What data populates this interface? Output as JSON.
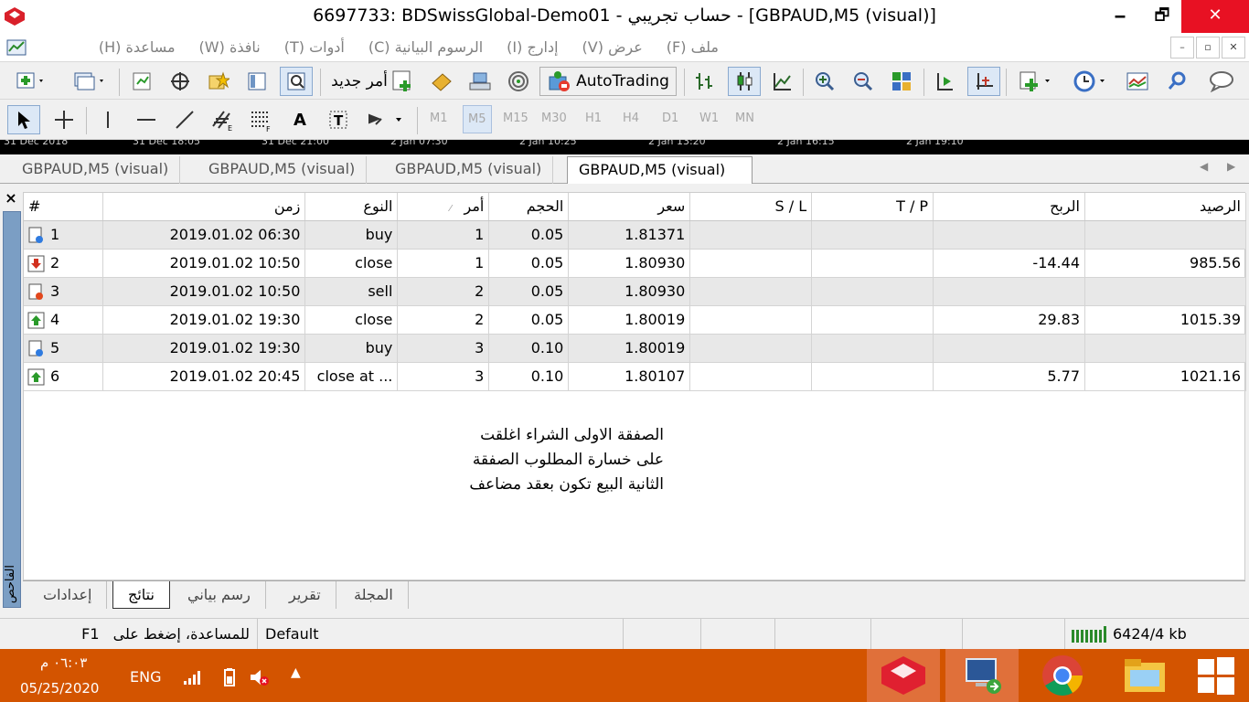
{
  "window": {
    "title": "6697733: BDSwissGlobal-Demo01 - حساب تجريبي - [GBPAUD,M5 (visual)]",
    "minimize": "🗕",
    "maximize": "🗗",
    "close": "✕"
  },
  "menu": {
    "items": [
      "ملف (F)",
      "عرض (V)",
      "إدارج (I)",
      "الرسوم البيانية (C)",
      "أدوات (T)",
      "نافذة (W)",
      "مساعدة (H)"
    ],
    "mdi_min": "–",
    "mdi_restore": "▫",
    "mdi_close": "✕"
  },
  "toolbar": {
    "new_order": "أمر جديد",
    "autotrading": "AutoTrading",
    "line_tools": [
      "T"
    ],
    "text_tool": "A",
    "timeframes": [
      "M1",
      "M5",
      "M15",
      "M30",
      "H1",
      "H4",
      "D1",
      "W1",
      "MN"
    ]
  },
  "chart_strip": {
    "labels": [
      "31 Dec 2018",
      "31 Dec 18:05",
      "31 Dec 21:00",
      "2 Jan 07:30",
      "2 Jan 10:25",
      "2 Jan 13:20",
      "2 Jan 16:15",
      "2 Jan 19:10"
    ]
  },
  "chart_tabs": [
    "GBPAUD,M5 (visual)",
    "GBPAUD,M5 (visual)",
    "GBPAUD,M5 (visual)",
    "GBPAUD,M5 (visual)"
  ],
  "panel": {
    "close": "×",
    "side_label": "الفاحص"
  },
  "columns": {
    "num": "#",
    "time": "زمن",
    "type": "النوع",
    "order": "أمر",
    "volume": "الحجم",
    "price": "سعر",
    "sl": "S / L",
    "tp": "T / P",
    "profit": "الربح",
    "balance": "الرصيد"
  },
  "rows": [
    {
      "num": "1",
      "time": "2019.01.02 06:30",
      "type": "buy",
      "order": "1",
      "volume": "0.05",
      "price": "1.81371",
      "sl": "",
      "tp": "",
      "profit": "",
      "balance": "",
      "icon": "buy-order-icon"
    },
    {
      "num": "2",
      "time": "2019.01.02 10:50",
      "type": "close",
      "order": "1",
      "volume": "0.05",
      "price": "1.80930",
      "sl": "",
      "tp": "",
      "profit": "-14.44",
      "balance": "985.56",
      "icon": "close-loss-icon"
    },
    {
      "num": "3",
      "time": "2019.01.02 10:50",
      "type": "sell",
      "order": "2",
      "volume": "0.05",
      "price": "1.80930",
      "sl": "",
      "tp": "",
      "profit": "",
      "balance": "",
      "icon": "sell-order-icon"
    },
    {
      "num": "4",
      "time": "2019.01.02 19:30",
      "type": "close",
      "order": "2",
      "volume": "0.05",
      "price": "1.80019",
      "sl": "",
      "tp": "",
      "profit": "29.83",
      "balance": "1015.39",
      "icon": "close-profit-icon"
    },
    {
      "num": "5",
      "time": "2019.01.02 19:30",
      "type": "buy",
      "order": "3",
      "volume": "0.10",
      "price": "1.80019",
      "sl": "",
      "tp": "",
      "profit": "",
      "balance": "",
      "icon": "buy-order-icon"
    },
    {
      "num": "6",
      "time": "2019.01.02 20:45",
      "type": "close at ...",
      "order": "3",
      "volume": "0.10",
      "price": "1.80107",
      "sl": "",
      "tp": "",
      "profit": "5.77",
      "balance": "1021.16",
      "icon": "close-profit-icon"
    }
  ],
  "note": {
    "line1": "الصفقة الاولى الشراء اغلقت",
    "line2": "على خسارة المطلوب الصفقة",
    "line3": "الثانية البيع تكون بعقد مضاعف"
  },
  "bottom_tabs": [
    "إعدادات",
    "نتائج",
    "رسم بياني",
    "تقرير",
    "المجلة"
  ],
  "status": {
    "help": "للمساعدة، إضغط على",
    "help_key": "F1",
    "profile": "Default",
    "traffic": "6424/4 kb"
  },
  "taskbar": {
    "time": "٠٦:٠٣ م",
    "date": "05/25/2020",
    "lang": "ENG"
  },
  "colors": {
    "taskbar": "#d35400",
    "close_btn": "#e81123",
    "sidebar": "#7b9ec4"
  }
}
